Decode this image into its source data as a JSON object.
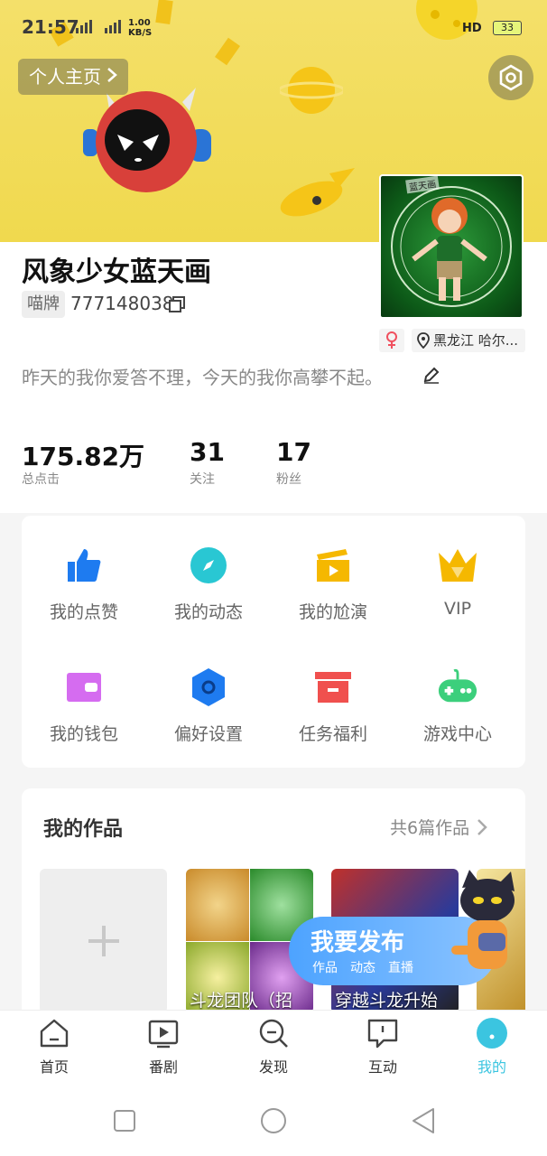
{
  "status_bar": {
    "time": "21:57",
    "network_speed": "1.00",
    "network_unit": "KB/S",
    "network_type": "4G",
    "hd_label": "HD",
    "battery": "33"
  },
  "header": {
    "home_chip_label": "个人主页"
  },
  "profile": {
    "name": "风象少女蓝天画",
    "id_badge": "喵牌",
    "id_value": "777148038",
    "location": "黑龙江 哈尔...",
    "bio": "昨天的我你爱答不理，今天的我你高攀不起。",
    "avatar_stamp": "蓝天画"
  },
  "stats": [
    {
      "value": "175.82万",
      "label": "总点击"
    },
    {
      "value": "31",
      "label": "关注"
    },
    {
      "value": "17",
      "label": "粉丝"
    }
  ],
  "grid": [
    {
      "label": "我的点赞",
      "icon": "thumbs-up-icon",
      "color": "#1e7bf0"
    },
    {
      "label": "我的动态",
      "icon": "compass-icon",
      "color": "#29c7d3"
    },
    {
      "label": "我的尬演",
      "icon": "clapperboard-icon",
      "color": "#f5b800"
    },
    {
      "label": "VIP",
      "icon": "crown-icon",
      "color": "#f5b800"
    },
    {
      "label": "我的钱包",
      "icon": "wallet-icon",
      "color": "#d56cf0"
    },
    {
      "label": "偏好设置",
      "icon": "hexagon-icon",
      "color": "#1e7bf0"
    },
    {
      "label": "任务福利",
      "icon": "gift-box-icon",
      "color": "#f0504e"
    },
    {
      "label": "游戏中心",
      "icon": "gamepad-icon",
      "color": "#3ccf7c"
    }
  ],
  "works": {
    "title": "我的作品",
    "count_label": "共6篇作品",
    "items": [
      {
        "caption": "斗龙团队（招"
      },
      {
        "caption": "穿越斗龙升始"
      }
    ]
  },
  "publish": {
    "main_label": "我要发布",
    "options": [
      "作品",
      "动态",
      "直播"
    ]
  },
  "bottom_nav": [
    {
      "label": "首页",
      "icon": "home-icon"
    },
    {
      "label": "番剧",
      "icon": "play-icon"
    },
    {
      "label": "发现",
      "icon": "search-icon"
    },
    {
      "label": "互动",
      "icon": "message-icon"
    },
    {
      "label": "我的",
      "icon": "profile-icon",
      "active": true
    }
  ],
  "colors": {
    "accent": "#3bc5e0",
    "banner": "#f0d94e"
  }
}
